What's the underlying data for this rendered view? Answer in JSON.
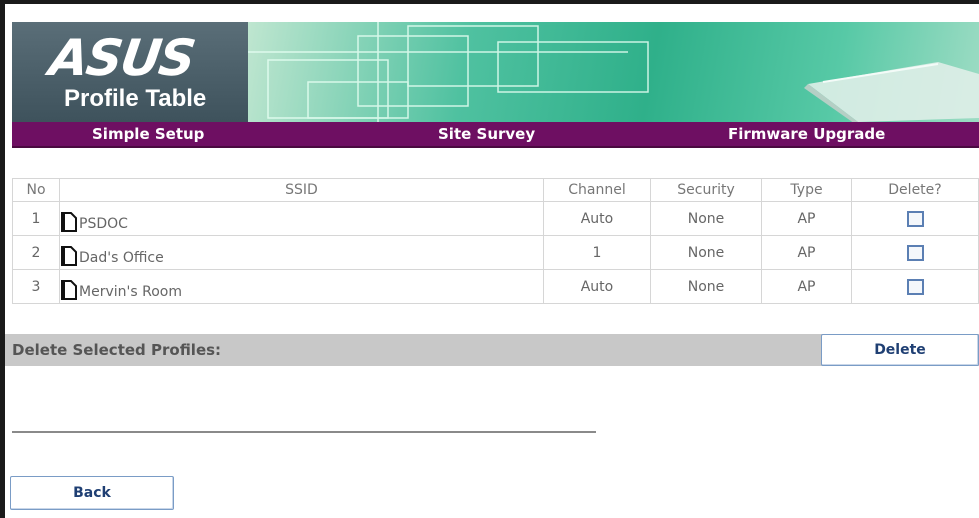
{
  "banner": {
    "logo": "ASUS",
    "subtitle": "Profile Table"
  },
  "nav": {
    "items": [
      {
        "label": "Simple Setup"
      },
      {
        "label": "Site Survey"
      },
      {
        "label": "Firmware Upgrade"
      }
    ],
    "color": "#6e0f62"
  },
  "table": {
    "headers": [
      "No",
      "SSID",
      "Channel",
      "Security",
      "Type",
      "Delete?"
    ],
    "rows": [
      {
        "no": "1",
        "ssid": "PSDOC",
        "channel": "Auto",
        "security": "None",
        "type": "AP",
        "delete_checked": false
      },
      {
        "no": "2",
        "ssid": "Dad's Office",
        "channel": "1",
        "security": "None",
        "type": "AP",
        "delete_checked": false
      },
      {
        "no": "3",
        "ssid": "Mervin's Room",
        "channel": "Auto",
        "security": "None",
        "type": "AP",
        "delete_checked": false
      }
    ]
  },
  "delete_section": {
    "label": "Delete Selected Profiles:",
    "button": "Delete"
  },
  "footer": {
    "back_button": "Back"
  },
  "icons": {
    "ssid_icon": "document-icon",
    "checkbox": "checkbox-icon"
  }
}
